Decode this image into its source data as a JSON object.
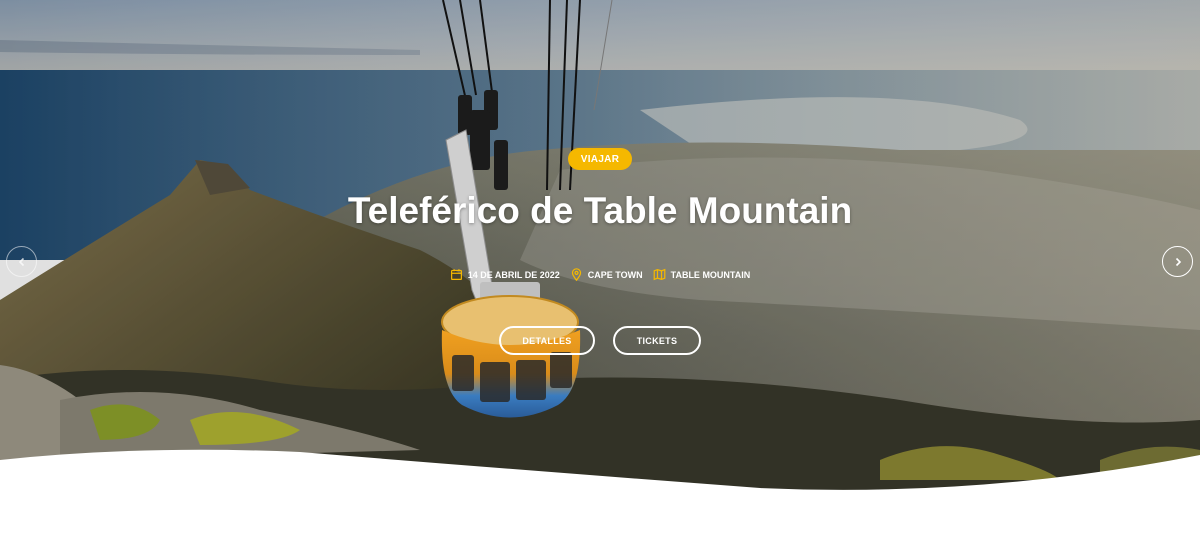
{
  "slide": {
    "category": "VIAJAR",
    "title": "Teleférico de Table Mountain",
    "meta": {
      "date": "14 DE ABRIL DE 2022",
      "city": "CAPE TOWN",
      "place": "TABLE MOUNTAIN"
    },
    "buttons": {
      "details": "DETALLES",
      "tickets": "TICKETS"
    }
  },
  "icons": {
    "date": "calendar-icon",
    "city": "map-pin-icon",
    "place": "map-icon",
    "prev": "chevron-left-icon",
    "next": "chevron-right-icon"
  },
  "colors": {
    "accent": "#f5b800",
    "text": "#ffffff"
  }
}
